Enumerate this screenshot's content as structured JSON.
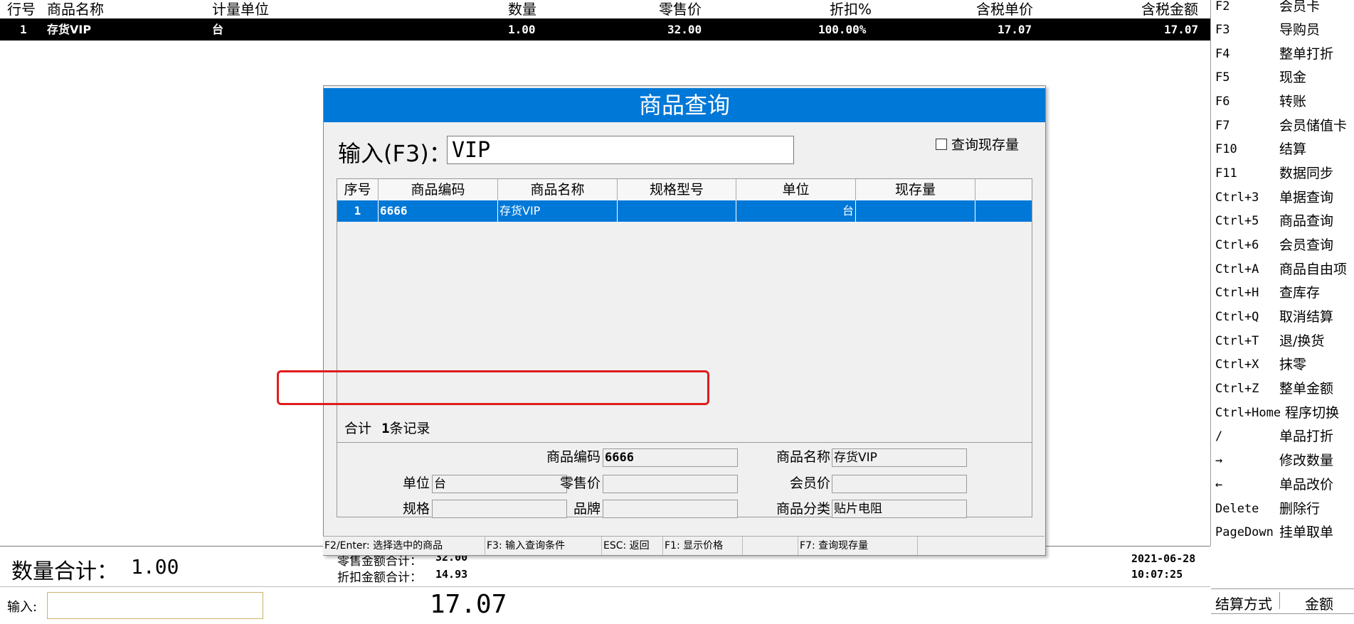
{
  "sale_table": {
    "headers": [
      "行号",
      "商品名称",
      "计量单位",
      "数量",
      "零售价",
      "折扣%",
      "含税单价",
      "含税金额"
    ],
    "rows": [
      {
        "line": "1",
        "name": "存货VIP",
        "unit": "台",
        "qty": "1.00",
        "retail": "32.00",
        "discount": "100.00%",
        "tax_price": "17.07",
        "tax_amount": "17.07"
      }
    ]
  },
  "totals": {
    "qty_label": "数量合计：",
    "qty_value": "1.00",
    "retail_total_label": "零售金额合计：",
    "retail_total_value": "32.00",
    "discount_total_label": "折扣金额合计：",
    "discount_total_value": "14.93",
    "date": "2021-06-28",
    "time": "10:07:25"
  },
  "bottom": {
    "input_label": "输入:",
    "input_value": "",
    "amount": "17.07",
    "pay_method_header": "结算方式",
    "pay_amount_header": "金额"
  },
  "shortcuts": [
    {
      "key": "F2",
      "label": "会员卡"
    },
    {
      "key": "F3",
      "label": "导购员"
    },
    {
      "key": "F4",
      "label": "整单打折"
    },
    {
      "key": "F5",
      "label": "现金"
    },
    {
      "key": "F6",
      "label": "转账"
    },
    {
      "key": "F7",
      "label": "会员储值卡"
    },
    {
      "key": "F10",
      "label": "结算"
    },
    {
      "key": "F11",
      "label": "数据同步"
    },
    {
      "key": "Ctrl+3",
      "label": "单据查询"
    },
    {
      "key": "Ctrl+5",
      "label": "商品查询"
    },
    {
      "key": "Ctrl+6",
      "label": "会员查询"
    },
    {
      "key": "Ctrl+A",
      "label": "商品自由项"
    },
    {
      "key": "Ctrl+H",
      "label": "查库存"
    },
    {
      "key": "Ctrl+Q",
      "label": "取消结算"
    },
    {
      "key": "Ctrl+T",
      "label": "退/换货"
    },
    {
      "key": "Ctrl+X",
      "label": "抹零"
    },
    {
      "key": "Ctrl+Z",
      "label": "整单金额"
    },
    {
      "key": "Ctrl+Home",
      "label": "程序切换"
    },
    {
      "key": "/",
      "label": "单品打折"
    },
    {
      "key": "→",
      "label": "修改数量"
    },
    {
      "key": "←",
      "label": "单品改价"
    },
    {
      "key": "Delete",
      "label": "删除行"
    },
    {
      "key": "PageDown",
      "label": "挂单取单"
    }
  ],
  "dialog": {
    "title": "商品查询",
    "input_label": "输入(F3)：",
    "input_value": "VIP",
    "stock_checkbox_label": "查询现存量",
    "columns": [
      "序号",
      "商品编码",
      "商品名称",
      "规格型号",
      "单位",
      "现存量"
    ],
    "rows": [
      {
        "no": "1",
        "code": "6666",
        "name": "存货VIP",
        "spec": "",
        "unit": "台",
        "stock": ""
      }
    ],
    "summary_label": "合计",
    "summary_count": "1",
    "summary_suffix": "条记录",
    "detail": {
      "code_label": "商品编码",
      "code_value": "6666",
      "name_label": "商品名称",
      "name_value": "存货VIP",
      "unit_label": "单位",
      "unit_value": "台",
      "retail_label": "零售价",
      "retail_value": "",
      "member_label": "会员价",
      "member_value": "",
      "spec_label": "规格",
      "spec_value": "",
      "brand_label": "品牌",
      "brand_value": "",
      "category_label": "商品分类",
      "category_value": "贴片电阻"
    },
    "hints": [
      "F2/Enter: 选择选中的商品",
      "F3: 输入查询条件",
      "ESC: 返回",
      "F1: 显示价格",
      "",
      "F7: 查询现存量",
      ""
    ]
  },
  "colors": {
    "accent": "#0078d7",
    "highlight": "#e01c1c",
    "selected_row": "#000000"
  }
}
